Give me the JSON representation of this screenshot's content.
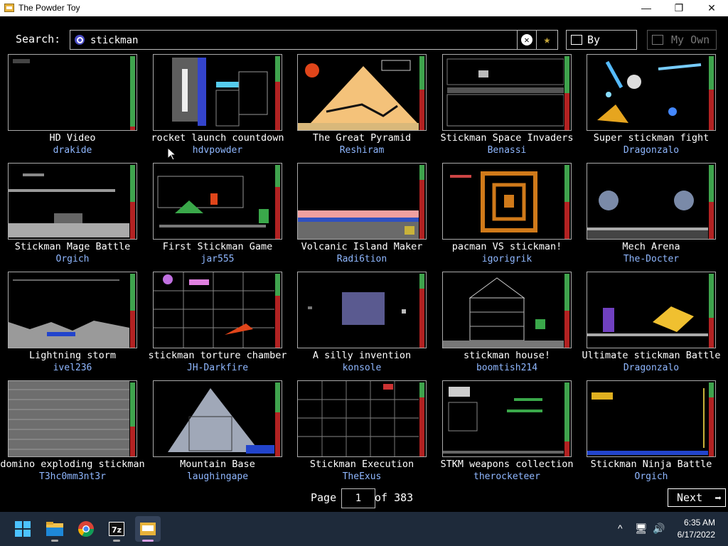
{
  "window": {
    "title": "The Powder Toy",
    "minimize": "—",
    "maximize": "❐",
    "close": "✕"
  },
  "search": {
    "label": "Search:",
    "value": "stickman",
    "clear_glyph": "✕",
    "fav_glyph": "★"
  },
  "sort_button": {
    "label": "By votes"
  },
  "own_button": {
    "label": "My Own"
  },
  "saves": [
    {
      "title": "HD Video",
      "author": "drakide",
      "votes_up": 0.95
    },
    {
      "title": "rocket launch countdown",
      "author": "hdvpowder",
      "votes_up": 0.35
    },
    {
      "title": "The Great Pyramid",
      "author": "Reshiram",
      "votes_up": 0.45
    },
    {
      "title": "Stickman Space Invaders",
      "author": "Benassi",
      "votes_up": 0.5
    },
    {
      "title": "Super stickman fight",
      "author": "Dragonzalo",
      "votes_up": 0.45
    },
    {
      "title": "Stickman Mage Battle",
      "author": "Orgich",
      "votes_up": 0.5
    },
    {
      "title": "First Stickman Game",
      "author": "jar555",
      "votes_up": 0.3
    },
    {
      "title": "Volcanic Island Maker",
      "author": "Radi6tion",
      "votes_up": 0.2
    },
    {
      "title": "pacman VS stickman!",
      "author": "igorigrik",
      "votes_up": 0.5
    },
    {
      "title": "Mech Arena",
      "author": "The-Docter",
      "votes_up": 0.5
    },
    {
      "title": "Lightning storm",
      "author": "ivel236",
      "votes_up": 0.5
    },
    {
      "title": "stickman torture chamber",
      "author": "JH-Darkfire",
      "votes_up": 0.3
    },
    {
      "title": "A silly invention",
      "author": "konsole",
      "votes_up": 0.2
    },
    {
      "title": "stickman house!",
      "author": "boomtish214",
      "votes_up": 0.5
    },
    {
      "title": "Ultimate stickman Battle",
      "author": "Dragonzalo",
      "votes_up": 0.6
    },
    {
      "title": "domino exploding stickman",
      "author": "T3hc0mm3nt3r",
      "votes_up": 0.6
    },
    {
      "title": "Mountain Base",
      "author": "laughingape",
      "votes_up": 0.4
    },
    {
      "title": "Stickman Execution",
      "author": "TheExus",
      "votes_up": 0.2
    },
    {
      "title": "STKM weapons collection",
      "author": "therocketeer",
      "votes_up": 0.8
    },
    {
      "title": "Stickman Ninja Battle",
      "author": "Orgich",
      "votes_up": 0.2
    }
  ],
  "pagination": {
    "page_label": "Page",
    "current_page": "1",
    "of_label": "of 383",
    "next_label": "Next",
    "next_arrow": "➡"
  },
  "colors": {
    "vote_up": "#3fa34d",
    "vote_down": "#b22222",
    "author": "#8fb7ff"
  },
  "taskbar": {
    "apps": [
      {
        "name": "start-icon",
        "active": false
      },
      {
        "name": "file-explorer-icon",
        "active": false
      },
      {
        "name": "chrome-icon",
        "active": false
      },
      {
        "name": "7zip-icon",
        "label": "7z",
        "active": false
      },
      {
        "name": "powder-toy-icon",
        "active": true
      }
    ],
    "tray_glyphs": [
      "^",
      "🖥",
      "🔊"
    ],
    "time": "6:35 AM",
    "date": "6/17/2022"
  }
}
